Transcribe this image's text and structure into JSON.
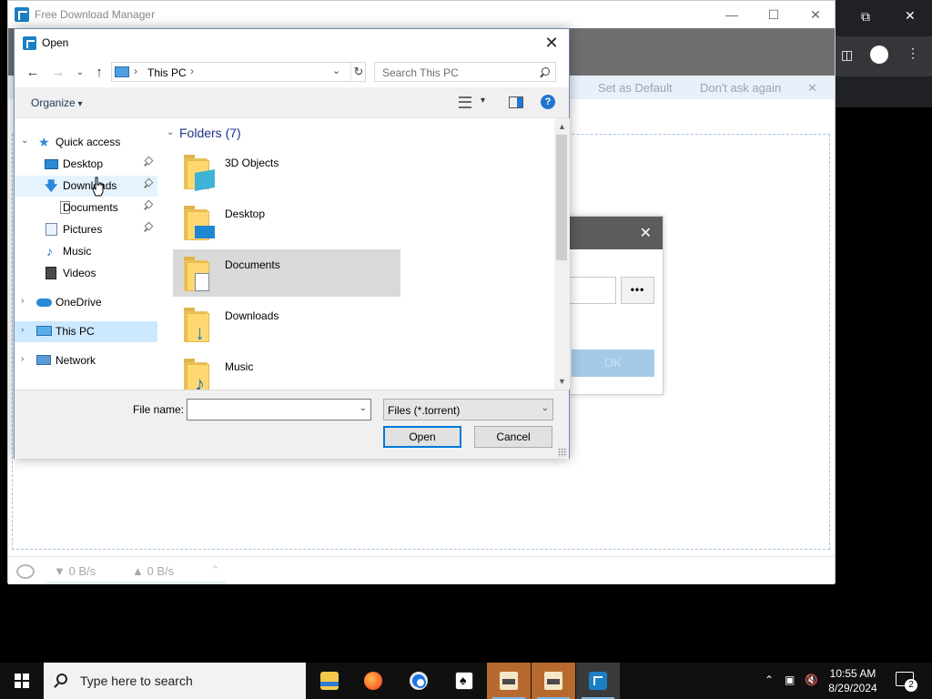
{
  "fdm_window": {
    "title": "Free Download Manager",
    "notify_set_default": "Set as Default",
    "notify_dont_ask": "Don't ask again",
    "download_speed": "▼ 0 B/s",
    "upload_speed": "▲ 0 B/s"
  },
  "add_dialog": {
    "more_label": "•••",
    "ok_label": "OK"
  },
  "open_dialog": {
    "title": "Open",
    "address": {
      "location": "This PC"
    },
    "search_placeholder": "Search This PC",
    "organize_label": "Organize",
    "nav": {
      "quick_access": "Quick access",
      "items": [
        {
          "label": "Desktop",
          "pinned": true
        },
        {
          "label": "Downloads",
          "pinned": true
        },
        {
          "label": "Documents",
          "pinned": true
        },
        {
          "label": "Pictures",
          "pinned": true
        },
        {
          "label": "Music",
          "pinned": false
        },
        {
          "label": "Videos",
          "pinned": false
        }
      ],
      "onedrive": "OneDrive",
      "this_pc": "This PC",
      "network": "Network"
    },
    "content": {
      "group_header": "Folders (7)",
      "folders": [
        {
          "label": "3D Objects",
          "icon": "3d-objects-folder-icon"
        },
        {
          "label": "Desktop",
          "icon": "desktop-folder-icon"
        },
        {
          "label": "Documents",
          "icon": "documents-folder-icon",
          "selected": true
        },
        {
          "label": "Downloads",
          "icon": "downloads-folder-icon"
        },
        {
          "label": "Music",
          "icon": "music-folder-icon"
        }
      ]
    },
    "file_name_label": "File name:",
    "file_name_value": "",
    "file_type": "Files (*.torrent)",
    "open_button": "Open",
    "cancel_button": "Cancel"
  },
  "taskbar": {
    "search_placeholder": "Type here to search",
    "time": "10:55 AM",
    "date": "8/29/2024",
    "notification_count": "2"
  },
  "colors": {
    "selection": "#cce8ff",
    "accent": "#0078d7",
    "folder": "#ffd872"
  }
}
